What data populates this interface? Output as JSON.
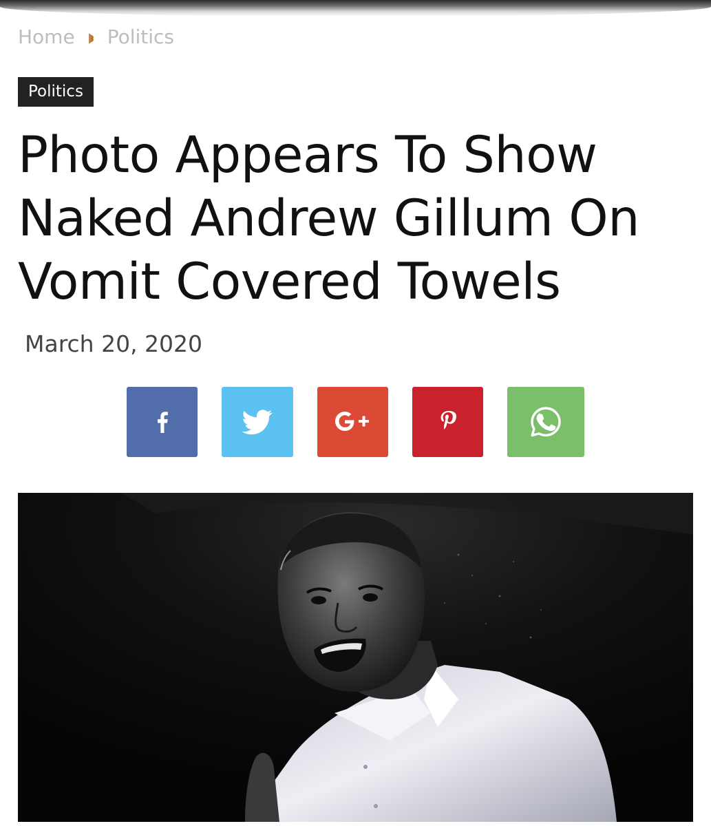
{
  "breadcrumb": {
    "home": "Home",
    "category": "Politics"
  },
  "article": {
    "category_badge": "Politics",
    "title": "Photo Appears To Show Naked Andrew Gillum On Vomit Covered Towels",
    "date": "March 20, 2020"
  },
  "share": {
    "buttons": [
      {
        "network": "facebook",
        "icon": "facebook-icon",
        "color": "#516eab"
      },
      {
        "network": "twitter",
        "icon": "twitter-icon",
        "color": "#5bc2f1"
      },
      {
        "network": "googleplus",
        "icon": "google-plus-icon",
        "color": "#dc4a36"
      },
      {
        "network": "pinterest",
        "icon": "pinterest-icon",
        "color": "#c8232c"
      },
      {
        "network": "whatsapp",
        "icon": "whatsapp-icon",
        "color": "#7bbf6a"
      }
    ]
  },
  "colors": {
    "badge_bg": "#222222",
    "breadcrumb_text": "#bdbdbd",
    "breadcrumb_separator": "#d98b3a",
    "title_text": "#111111"
  }
}
